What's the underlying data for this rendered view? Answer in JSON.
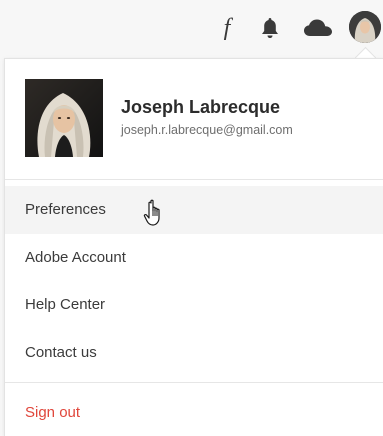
{
  "topbar": {
    "icons": [
      "fonts-icon",
      "bell-icon",
      "cloud-icon",
      "avatar"
    ],
    "fonts_glyph": "f"
  },
  "profile": {
    "name": "Joseph Labrecque",
    "email": "joseph.r.labrecque@gmail.com"
  },
  "menu": {
    "items": [
      {
        "label": "Preferences",
        "hovered": true
      },
      {
        "label": "Adobe Account",
        "hovered": false
      },
      {
        "label": "Help Center",
        "hovered": false
      },
      {
        "label": "Contact us",
        "hovered": false
      }
    ],
    "sign_out": "Sign out"
  },
  "colors": {
    "sign_out": "#e0463b",
    "hover_bg": "#f4f4f4",
    "text": "#3b3b3b"
  }
}
